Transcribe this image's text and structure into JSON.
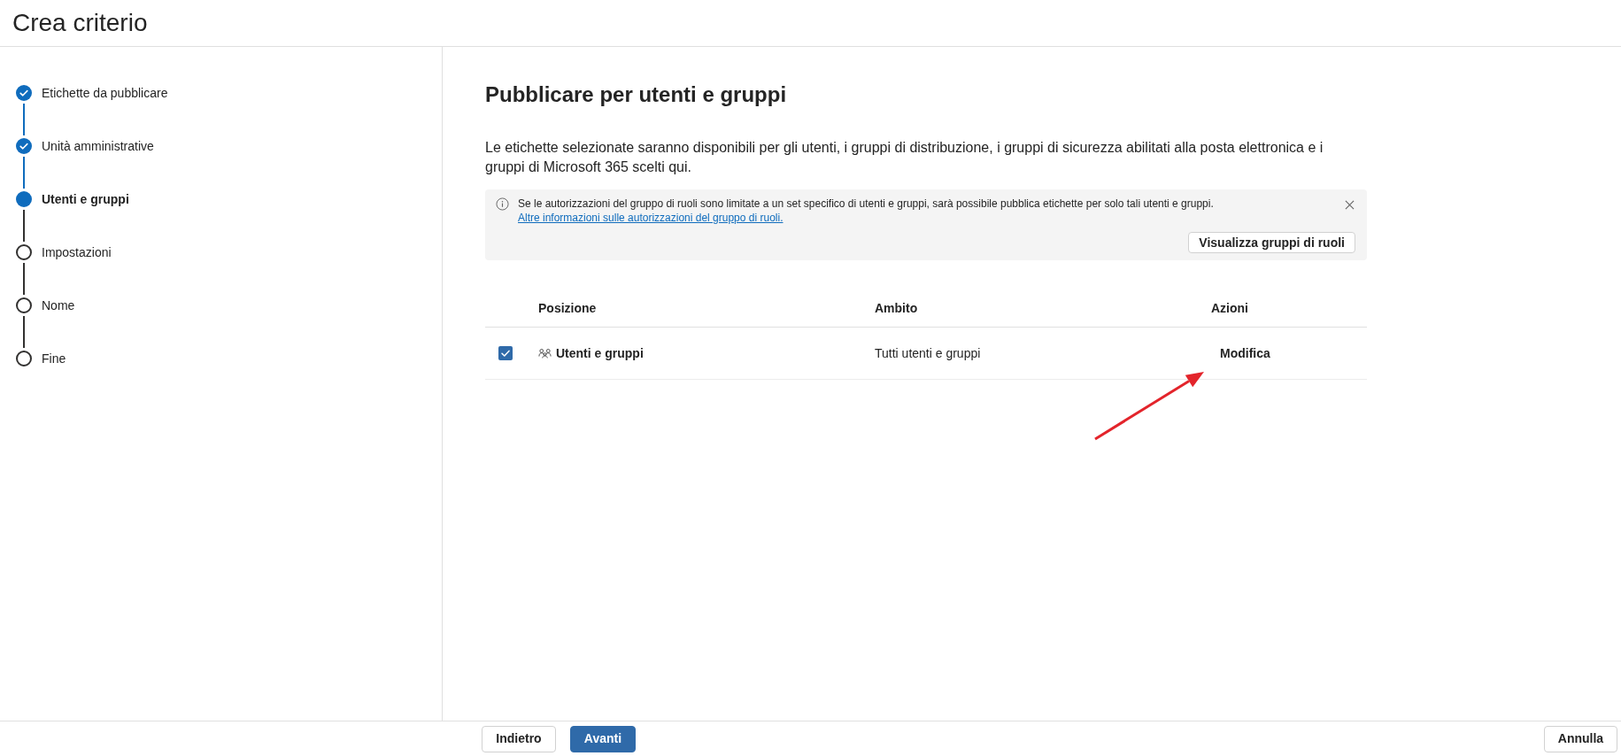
{
  "header": {
    "title": "Crea criterio"
  },
  "steps": [
    {
      "label": "Etichette da pubblicare",
      "completed": true,
      "selected": false
    },
    {
      "label": "Unità amministrative",
      "completed": true,
      "selected": false
    },
    {
      "label": "Utenti e gruppi",
      "completed": false,
      "selected": true
    },
    {
      "label": "Impostazioni",
      "completed": false,
      "selected": false
    },
    {
      "label": "Nome",
      "completed": false,
      "selected": false
    },
    {
      "label": "Fine",
      "completed": false,
      "selected": false
    }
  ],
  "main": {
    "heading": "Pubblicare per utenti e gruppi",
    "description": "Le etichette selezionate saranno disponibili per gli utenti, i gruppi di distribuzione, i gruppi di sicurezza abilitati alla posta elettronica e i gruppi di Microsoft 365 scelti qui."
  },
  "info_banner": {
    "text": "Se le autorizzazioni del gruppo di ruoli sono limitate a un set specifico di utenti e gruppi, sarà possibile pubblica etichette per solo tali utenti e gruppi.",
    "link": "Altre informazioni sulle autorizzazioni del gruppo di ruoli.",
    "button": "Visualizza gruppi di ruoli"
  },
  "table": {
    "columns": [
      "Posizione",
      "Ambito",
      "Azioni"
    ],
    "rows": [
      {
        "checked": true,
        "location": "Utenti e gruppi",
        "scope": "Tutti utenti e gruppi",
        "action": "Modifica"
      }
    ]
  },
  "footer": {
    "buttons": [
      {
        "label": "Indietro",
        "kind": "secondary"
      },
      {
        "label": "Avanti",
        "kind": "primary"
      }
    ],
    "cancel_button": "Annulla"
  }
}
